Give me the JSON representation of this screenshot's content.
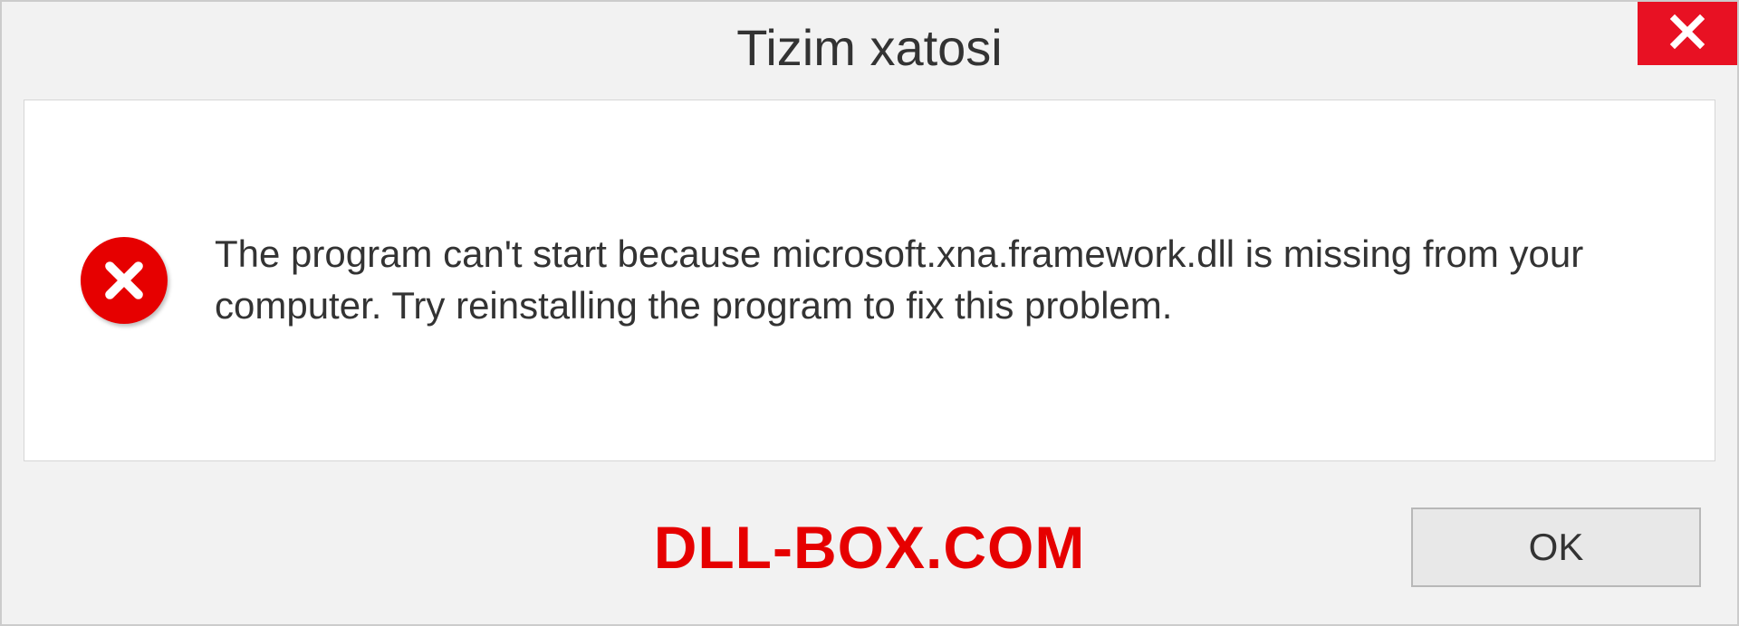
{
  "dialog": {
    "title": "Tizim xatosi",
    "message": "The program can't start because microsoft.xna.framework.dll is missing from your computer. Try reinstalling the program to fix this problem.",
    "ok_label": "OK"
  },
  "watermark": "DLL-BOX.COM",
  "colors": {
    "close_bg": "#e81123",
    "error_red": "#e60000",
    "panel_bg": "#f2f2f2"
  }
}
